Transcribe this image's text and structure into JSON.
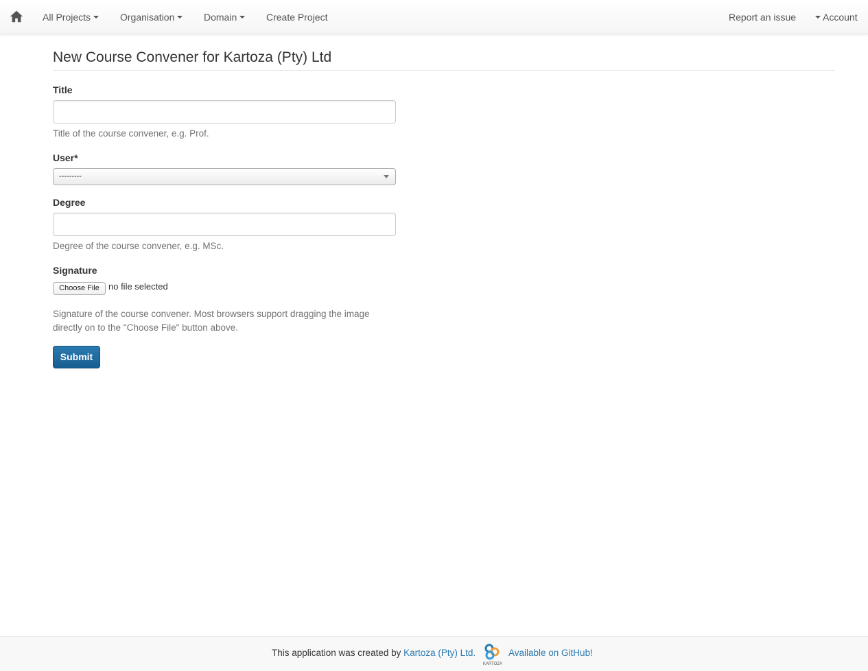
{
  "nav": {
    "home_icon": "home-icon",
    "all_projects": "All Projects",
    "organisation": "Organisation",
    "domain": "Domain",
    "create_project": "Create Project",
    "report_issue": "Report an issue",
    "account": "Account"
  },
  "page": {
    "title": "New Course Convener for Kartoza (Pty) Ltd"
  },
  "form": {
    "title_label": "Title",
    "title_help": "Title of the course convener, e.g. Prof.",
    "user_label": "User*",
    "user_selected": "---------",
    "degree_label": "Degree",
    "degree_help": "Degree of the course convener, e.g. MSc.",
    "signature_label": "Signature",
    "choose_file": "Choose File",
    "file_status": "no file selected",
    "signature_help": "Signature of the course convener. Most browsers support dragging the image directly on to the \"Choose File\" button above.",
    "submit": "Submit"
  },
  "footer": {
    "prefix": "This application was created by ",
    "company_link": "Kartoza (Pty) Ltd.",
    "github_link": "Available on GitHub!",
    "logo_text": "KARTOZA"
  },
  "colors": {
    "link": "#2a7ab0",
    "submit_bg": "#1f6ea4"
  }
}
